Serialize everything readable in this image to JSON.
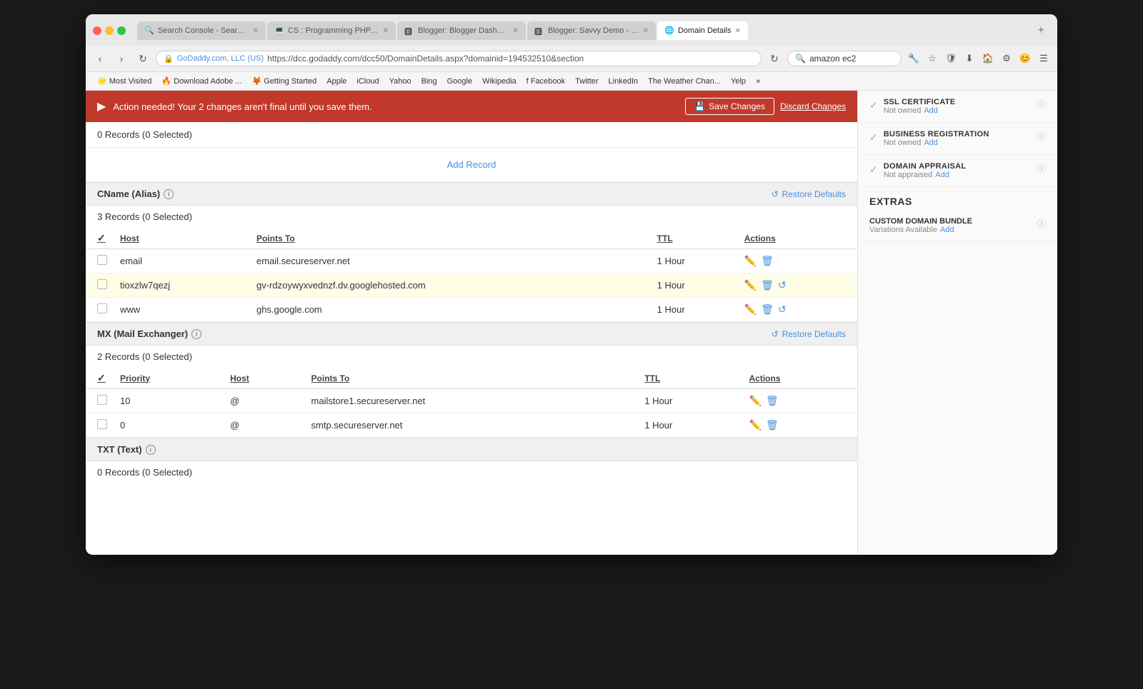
{
  "browser": {
    "tabs": [
      {
        "id": "tab1",
        "label": "Search Console - Search A...",
        "icon": "🔍",
        "active": false,
        "closeable": true
      },
      {
        "id": "tab2",
        "label": "CS : Programming PHP, JQ...",
        "icon": "💻",
        "active": false,
        "closeable": true
      },
      {
        "id": "tab3",
        "label": "Blogger: Blogger Dashboard",
        "icon": "🅱",
        "active": false,
        "closeable": true
      },
      {
        "id": "tab4",
        "label": "Blogger: Savvy Demo - Bas...",
        "icon": "🅱",
        "active": false,
        "closeable": true
      },
      {
        "id": "tab5",
        "label": "Domain Details",
        "icon": "🌐",
        "active": true,
        "closeable": true
      }
    ],
    "new_tab_label": "+",
    "address_bar": {
      "url": "https://dcc.godaddy.com/dcc50/DomainDetails.aspx?domainid=194532510&section",
      "secure_label": "GoDaddy.com, LLC (US)",
      "lock_icon": "🔒"
    },
    "search_bar": {
      "value": "amazon ec2",
      "placeholder": "Search"
    }
  },
  "bookmarks": [
    {
      "id": "bk1",
      "label": "Most Visited",
      "icon": "🌟"
    },
    {
      "id": "bk2",
      "label": "Download Adobe ...",
      "icon": "🔥"
    },
    {
      "id": "bk3",
      "label": "Getting Started",
      "icon": "🦊"
    },
    {
      "id": "bk4",
      "label": "Apple",
      "icon": ""
    },
    {
      "id": "bk5",
      "label": "iCloud",
      "icon": ""
    },
    {
      "id": "bk6",
      "label": "Yahoo",
      "icon": ""
    },
    {
      "id": "bk7",
      "label": "Bing",
      "icon": ""
    },
    {
      "id": "bk8",
      "label": "Google",
      "icon": ""
    },
    {
      "id": "bk9",
      "label": "Wikipedia",
      "icon": ""
    },
    {
      "id": "bk10",
      "label": "Facebook",
      "icon": "f"
    },
    {
      "id": "bk11",
      "label": "Twitter",
      "icon": ""
    },
    {
      "id": "bk12",
      "label": "LinkedIn",
      "icon": ""
    },
    {
      "id": "bk13",
      "label": "The Weather Chan...",
      "icon": ""
    },
    {
      "id": "bk14",
      "label": "Yelp",
      "icon": ""
    },
    {
      "id": "bk15",
      "label": "»",
      "icon": ""
    }
  ],
  "alert": {
    "icon": "▶",
    "message": "Action needed! Your 2 changes aren't final until you save them.",
    "save_label": "Save Changes",
    "discard_label": "Discard Changes"
  },
  "top_section": {
    "records_count": "0 Records (0 Selected)",
    "add_record_label": "Add Record"
  },
  "cname_section": {
    "title": "CName (Alias)",
    "records_count": "3 Records (0 Selected)",
    "restore_label": "Restore Defaults",
    "columns": [
      "Host",
      "Points To",
      "TTL",
      "Actions"
    ],
    "rows": [
      {
        "id": "cname1",
        "host": "email",
        "points_to": "email.secureserver.net",
        "ttl": "1 Hour",
        "highlighted": false,
        "has_undo": false
      },
      {
        "id": "cname2",
        "host": "tioxzlw7qezj",
        "points_to": "gv-rdzoywyxvednzf.dv.googlehosted.com",
        "ttl": "1 Hour",
        "highlighted": true,
        "has_undo": true
      },
      {
        "id": "cname3",
        "host": "www",
        "points_to": "ghs.google.com",
        "ttl": "1 Hour",
        "highlighted": false,
        "has_undo": true
      }
    ]
  },
  "mx_section": {
    "title": "MX (Mail Exchanger)",
    "records_count": "2 Records (0 Selected)",
    "restore_label": "Restore Defaults",
    "columns": [
      "Priority",
      "Host",
      "Points To",
      "TTL",
      "Actions"
    ],
    "rows": [
      {
        "id": "mx1",
        "priority": "10",
        "host": "@",
        "points_to": "mailstore1.secureserver.net",
        "ttl": "1 Hour"
      },
      {
        "id": "mx2",
        "priority": "0",
        "host": "@",
        "points_to": "smtp.secureserver.net",
        "ttl": "1 Hour"
      }
    ]
  },
  "txt_section": {
    "title": "TXT (Text)",
    "records_count": "0 Records (0 Selected)"
  },
  "sidebar": {
    "ssl_item": {
      "title": "SSL CERTIFICATE",
      "status": "Not owned",
      "add_label": "Add"
    },
    "business_item": {
      "title": "BUSINESS REGISTRATION",
      "status": "Not owned",
      "add_label": "Add"
    },
    "domain_item": {
      "title": "DOMAIN APPRAISAL",
      "status": "Not appraised",
      "add_label": "Add"
    },
    "extras_title": "EXTRAS",
    "custom_domain": {
      "title": "CUSTOM DOMAIN BUNDLE",
      "sub": "Variations Available",
      "add_label": "Add"
    }
  }
}
